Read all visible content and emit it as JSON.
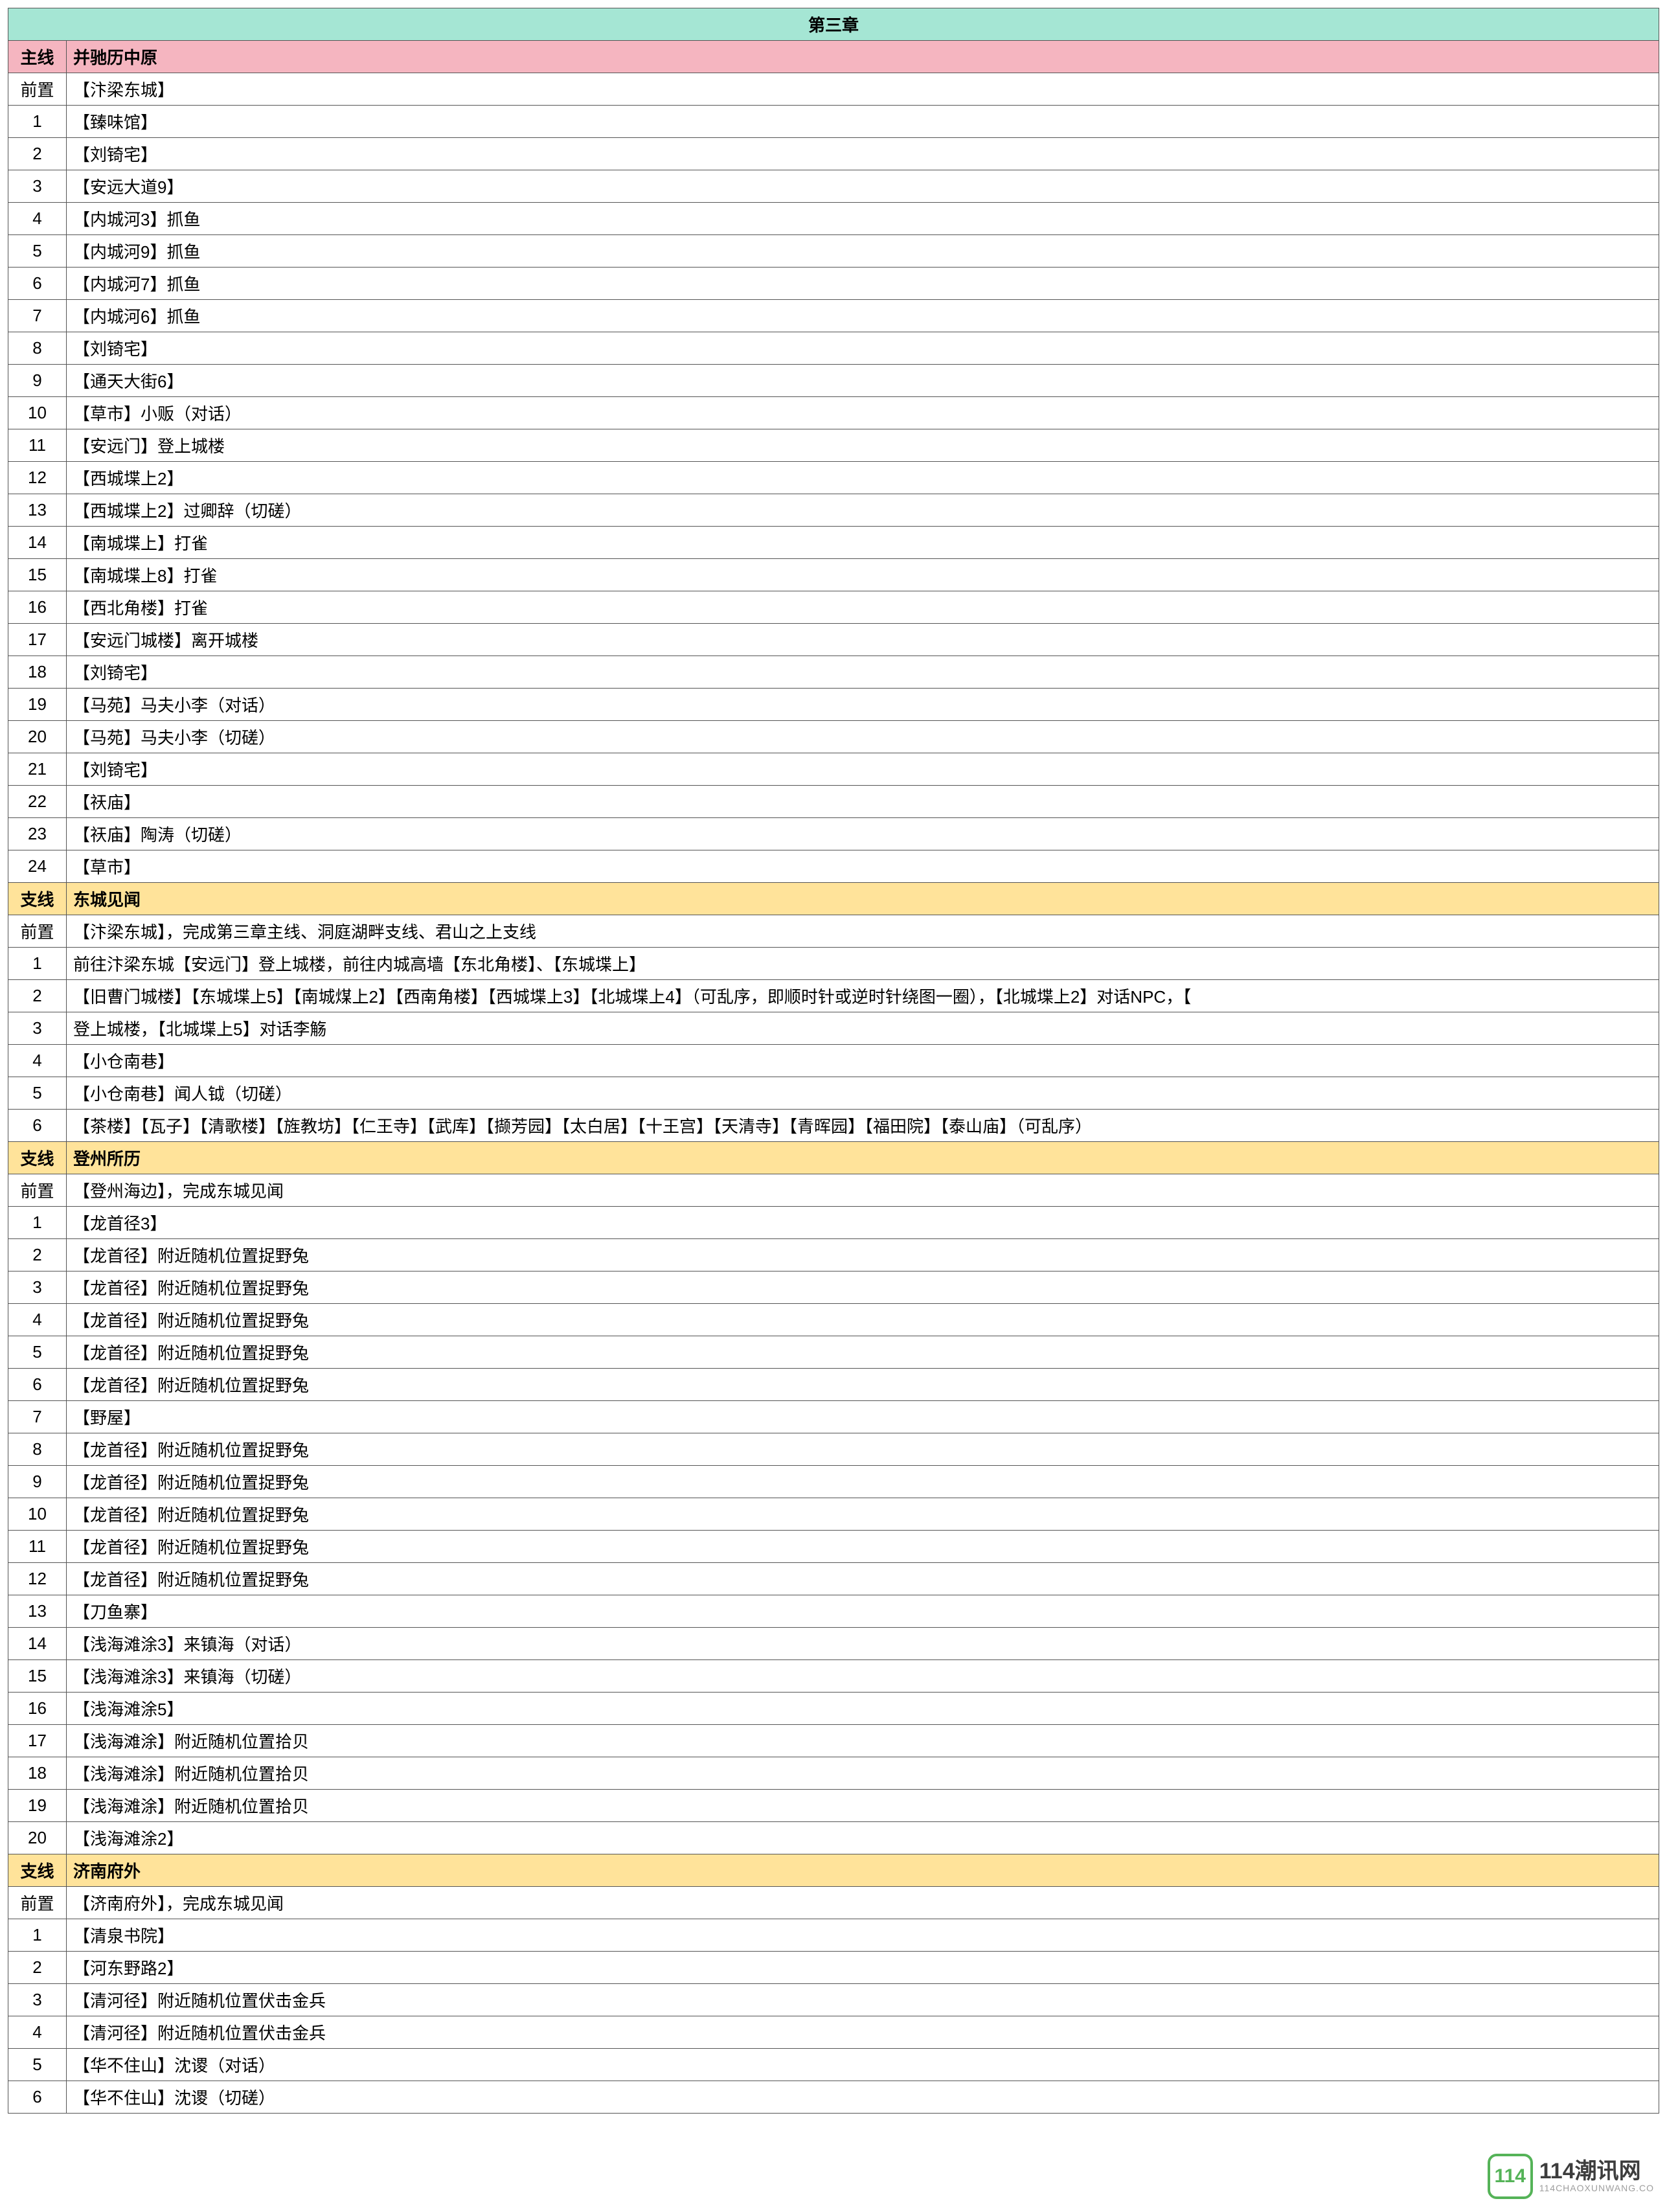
{
  "chapter_title": "第三章",
  "labels": {
    "pre": "前置",
    "main": "主线",
    "side": "支线"
  },
  "sections": [
    {
      "type": "main",
      "title": "并驰历中原",
      "pre": "【汴梁东城】",
      "rows": [
        "【臻味馆】",
        "【刘锜宅】",
        "【安远大道9】",
        "【内城河3】抓鱼",
        "【内城河9】抓鱼",
        "【内城河7】抓鱼",
        "【内城河6】抓鱼",
        "【刘锜宅】",
        "【通天大街6】",
        "【草市】小贩（对话）",
        "【安远门】登上城楼",
        "【西城堞上2】",
        "【西城堞上2】过卿辞（切磋）",
        "【南城堞上】打雀",
        "【南城堞上8】打雀",
        "【西北角楼】打雀",
        "【安远门城楼】离开城楼",
        "【刘锜宅】",
        "【马苑】马夫小李（对话）",
        "【马苑】马夫小李（切磋）",
        "【刘锜宅】",
        "【祆庙】",
        "【祆庙】陶涛（切磋）",
        "【草市】"
      ]
    },
    {
      "type": "side",
      "title": "东城见闻",
      "pre": "【汴梁东城】，完成第三章主线、洞庭湖畔支线、君山之上支线",
      "rows": [
        "前往汴梁东城【安远门】登上城楼，前往内城高墙【东北角楼】、【东城堞上】",
        "【旧曹门城楼】【东城堞上5】【南城煤上2】【西南角楼】【西城堞上3】【北城堞上4】（可乱序，即顺时针或逆时针绕图一圈），【北城堞上2】对话NPC，【",
        "登上城楼，【北城堞上5】对话李觞",
        "【小仓南巷】",
        "【小仓南巷】闻人钺（切磋）",
        "【茶楼】【瓦子】【清歌楼】【旌教坊】【仁王寺】【武库】【撷芳园】【太白居】【十王宫】【天清寺】【青晖园】【福田院】【泰山庙】（可乱序）"
      ]
    },
    {
      "type": "side",
      "title": "登州所历",
      "pre": "【登州海边】，完成东城见闻",
      "rows": [
        "【龙首径3】",
        "【龙首径】附近随机位置捉野兔",
        "【龙首径】附近随机位置捉野兔",
        "【龙首径】附近随机位置捉野兔",
        "【龙首径】附近随机位置捉野兔",
        "【龙首径】附近随机位置捉野兔",
        "【野屋】",
        "【龙首径】附近随机位置捉野兔",
        "【龙首径】附近随机位置捉野兔",
        "【龙首径】附近随机位置捉野兔",
        "【龙首径】附近随机位置捉野兔",
        "【龙首径】附近随机位置捉野兔",
        "【刀鱼寨】",
        "【浅海滩涂3】来镇海（对话）",
        "【浅海滩涂3】来镇海（切磋）",
        "【浅海滩涂5】",
        "【浅海滩涂】附近随机位置拾贝",
        "【浅海滩涂】附近随机位置拾贝",
        "【浅海滩涂】附近随机位置拾贝",
        "【浅海滩涂2】"
      ]
    },
    {
      "type": "side",
      "title": "济南府外",
      "pre": "【济南府外】，完成东城见闻",
      "rows": [
        "【清泉书院】",
        "【河东野路2】",
        "【清河径】附近随机位置伏击金兵",
        "【清河径】附近随机位置伏击金兵",
        "【华不住山】沈谡（对话）",
        "【华不住山】沈谡（切磋）"
      ]
    }
  ],
  "watermark": {
    "badge": "114",
    "main": "114潮讯网",
    "sub": "114CHAOXUNWANG.CO"
  }
}
